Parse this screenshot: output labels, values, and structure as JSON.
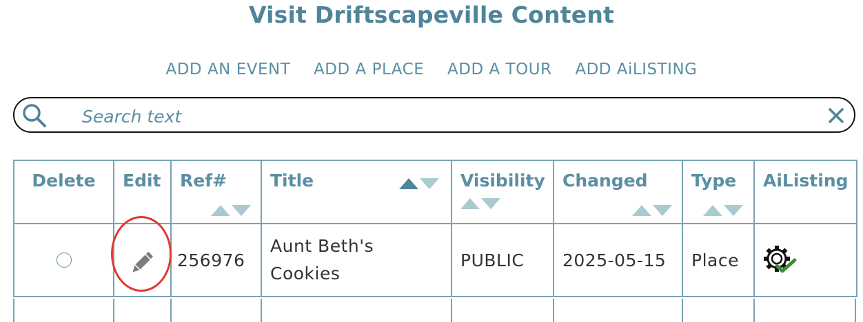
{
  "header": {
    "title": "Visit Driftscapeville Content"
  },
  "actions": [
    {
      "label": "ADD AN EVENT"
    },
    {
      "label": "ADD A PLACE"
    },
    {
      "label": "ADD A TOUR"
    },
    {
      "label": "ADD AiLISTING"
    }
  ],
  "search": {
    "placeholder": "Search text",
    "value": ""
  },
  "table": {
    "columns": {
      "delete": "Delete",
      "edit": "Edit",
      "ref": "Ref#",
      "title": "Title",
      "visibility": "Visibility",
      "changed": "Changed",
      "type": "Type",
      "ailisting": "AiListing"
    },
    "sort_active": "title-ascending",
    "rows": [
      {
        "ref": "256976",
        "title_line1": "Aunt Beth's",
        "title_line2": "Cookies",
        "visibility": "PUBLIC",
        "changed": "2025-05-15",
        "type": "Place",
        "ailisting_icon": "gear-check-icon"
      }
    ]
  },
  "colors": {
    "accent": "#5a8fa3",
    "heading": "#4f8499",
    "border": "#79a3b3",
    "highlight": "#e03a2f",
    "check": "#3e8e3a"
  }
}
